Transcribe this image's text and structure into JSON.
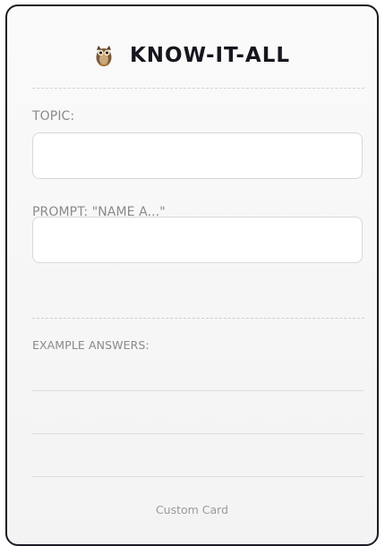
{
  "card": {
    "icon": "owl-icon",
    "title": "KNOW-IT-ALL",
    "topic_label": "TOPIC:",
    "topic_value": "",
    "prompt_label": "PROMPT: \"NAME A...\"",
    "prompt_value": "",
    "examples_label": "EXAMPLE ANSWERS:",
    "footer": "Custom Card"
  },
  "colors": {
    "border": "#1c1c26",
    "title": "#16161e",
    "label": "#8a8a8a",
    "background": "#f6f6f6"
  }
}
